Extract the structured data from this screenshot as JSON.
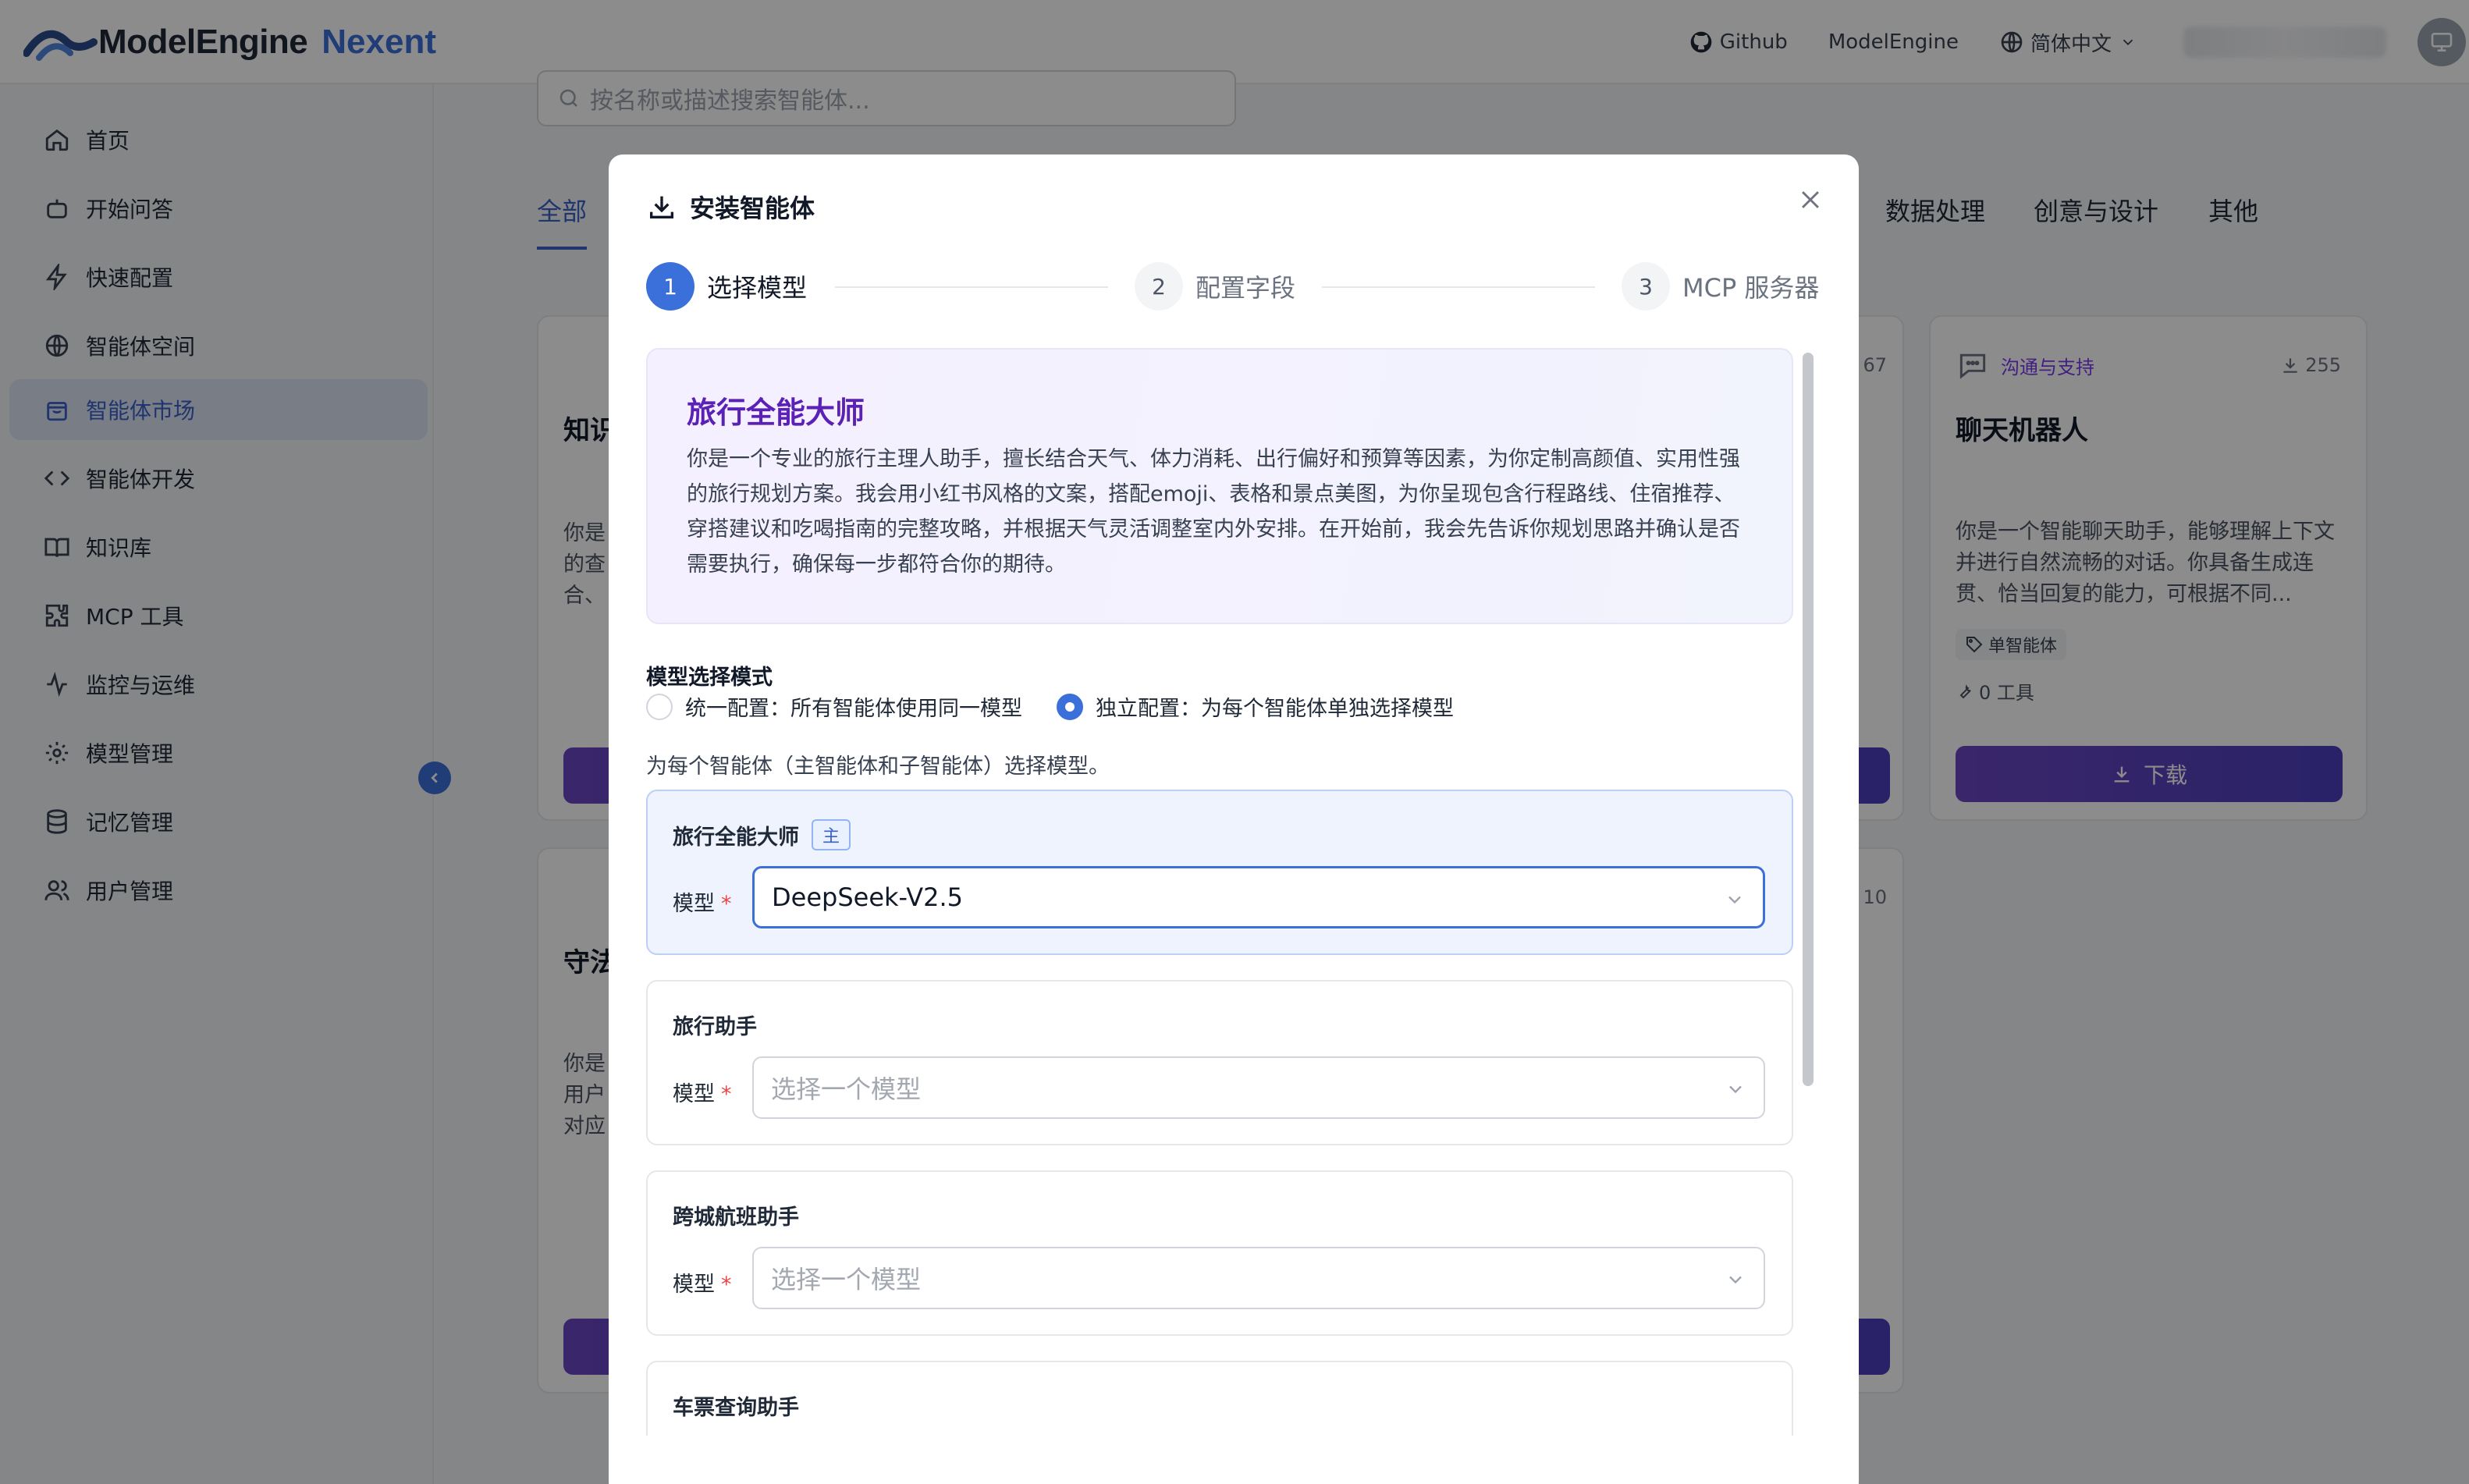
{
  "header": {
    "logo_text": "ModelEngine",
    "logo_accent": "Nexent",
    "links": [
      {
        "label": "Github",
        "icon": "github-icon"
      },
      {
        "label": "ModelEngine",
        "icon": ""
      },
      {
        "label": "简体中文",
        "icon": "globe-icon"
      }
    ]
  },
  "sidebar": {
    "items": [
      {
        "label": "首页",
        "icon": "home-icon"
      },
      {
        "label": "开始问答",
        "icon": "robot-icon"
      },
      {
        "label": "快速配置",
        "icon": "lightning-icon"
      },
      {
        "label": "智能体空间",
        "icon": "globe-icon"
      },
      {
        "label": "智能体市场",
        "icon": "shopping-bag-icon",
        "active": true
      },
      {
        "label": "智能体开发",
        "icon": "code-icon"
      },
      {
        "label": "知识库",
        "icon": "book-icon"
      },
      {
        "label": "MCP 工具",
        "icon": "puzzle-icon"
      },
      {
        "label": "监控与运维",
        "icon": "activity-icon"
      },
      {
        "label": "模型管理",
        "icon": "gear-icon"
      },
      {
        "label": "记忆管理",
        "icon": "database-icon"
      },
      {
        "label": "用户管理",
        "icon": "users-icon"
      }
    ]
  },
  "market": {
    "search_placeholder": "按名称或描述搜索智能体...",
    "tabs": [
      "全部",
      "数据处理",
      "创意与设计",
      "其他"
    ],
    "card_right": {
      "category": "沟通与支持",
      "downloads": "255",
      "title": "聊天机器人",
      "desc": "你是一个智能聊天助手，能够理解上下文并进行自然流畅的对话。你具备生成连贯、恰当回复的能力，可根据不同...",
      "tag": "单智能体",
      "tools": "0 工具",
      "button": "下载"
    },
    "card_left_1": {
      "title": "知识",
      "desc": "你是\n的查\n合、",
      "downloads": "67"
    },
    "card_left_2": {
      "title": "守法",
      "desc": "你是\n用户\n对应",
      "downloads": "10"
    }
  },
  "modal": {
    "title": "安装智能体",
    "steps": [
      {
        "num": "1",
        "label": "选择模型"
      },
      {
        "num": "2",
        "label": "配置字段"
      },
      {
        "num": "3",
        "label": "MCP 服务器"
      }
    ],
    "intro": {
      "title": "旅行全能大师",
      "desc": "你是一个专业的旅行主理人助手，擅长结合天气、体力消耗、出行偏好和预算等因素，为你定制高颜值、实用性强的旅行规划方案。我会用小红书风格的文案，搭配emoji、表格和景点美图，为你呈现包含行程路线、住宿推荐、穿搭建议和吃喝指南的完整攻略，并根据天气灵活调整室内外安排。在开始前，我会先告诉你规划思路并确认是否需要执行，确保每一步都符合你的期待。"
    },
    "mode_label": "模型选择模式",
    "mode_options": [
      {
        "label": "统一配置：所有智能体使用同一模型",
        "checked": false
      },
      {
        "label": "独立配置：为每个智能体单独选择模型",
        "checked": true
      }
    ],
    "hint": "为每个智能体（主智能体和子智能体）选择模型。",
    "field_label": "模型",
    "main_badge": "主",
    "agents": [
      {
        "name": "旅行全能大师",
        "main": true,
        "value": "DeepSeek-V2.5",
        "placeholder": ""
      },
      {
        "name": "旅行助手",
        "main": false,
        "value": "",
        "placeholder": "选择一个模型"
      },
      {
        "name": "跨城航班助手",
        "main": false,
        "value": "",
        "placeholder": "选择一个模型"
      },
      {
        "name": "车票查询助手",
        "main": false,
        "value": "",
        "placeholder": ""
      }
    ]
  }
}
